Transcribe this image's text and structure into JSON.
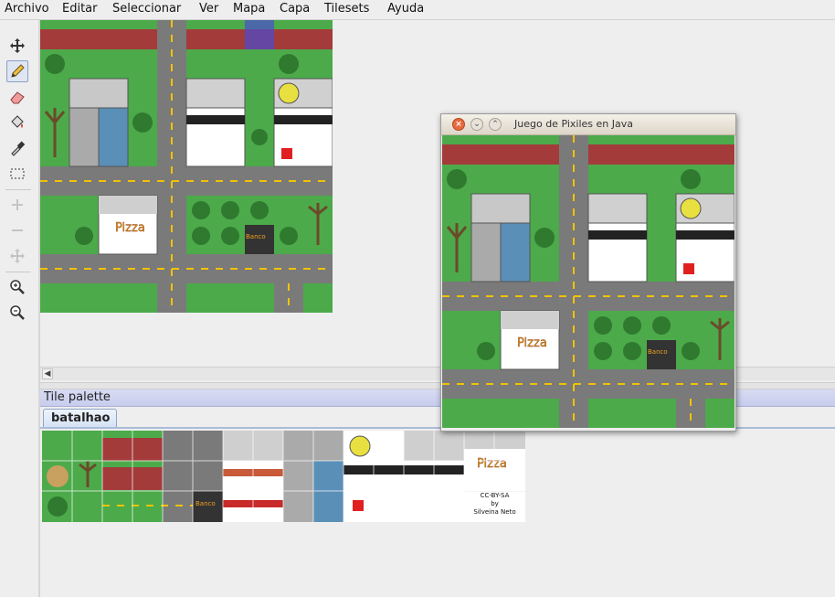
{
  "menubar": {
    "items": [
      "Archivo",
      "Editar",
      "Seleccionar",
      "Ver",
      "Mapa",
      "Capa",
      "Tilesets",
      "Ayuda"
    ]
  },
  "toolbar": {
    "tools": [
      "move-icon",
      "pencil-icon",
      "eraser-icon",
      "bucket-fill-icon",
      "eyedropper-icon",
      "rect-select-icon",
      "add-icon",
      "remove-icon",
      "move-layer-icon",
      "zoom-in-icon",
      "zoom-out-icon"
    ],
    "selected_tool": "pencil-icon"
  },
  "map": {
    "sign_pizza": "Pizza",
    "sign_banco": "Banco"
  },
  "tile_palette": {
    "title": "Tile palette",
    "tab_label": "batalhao",
    "pizza_sign": "Pizza",
    "banco_sign": "Banco",
    "credit_line1": "CC-BY-SA",
    "credit_line2": "by",
    "credit_line3": "Silveina Neto"
  },
  "game_window": {
    "title": "Juego de Pixiles en Java",
    "sign_pizza": "Pizza",
    "sign_banco": "Banco"
  },
  "colors": {
    "grass": "#4caa4a",
    "road": "#7a7a7a",
    "lane": "#f2c200",
    "brick": "#a33b3b",
    "accent": "#4b4bd0"
  }
}
